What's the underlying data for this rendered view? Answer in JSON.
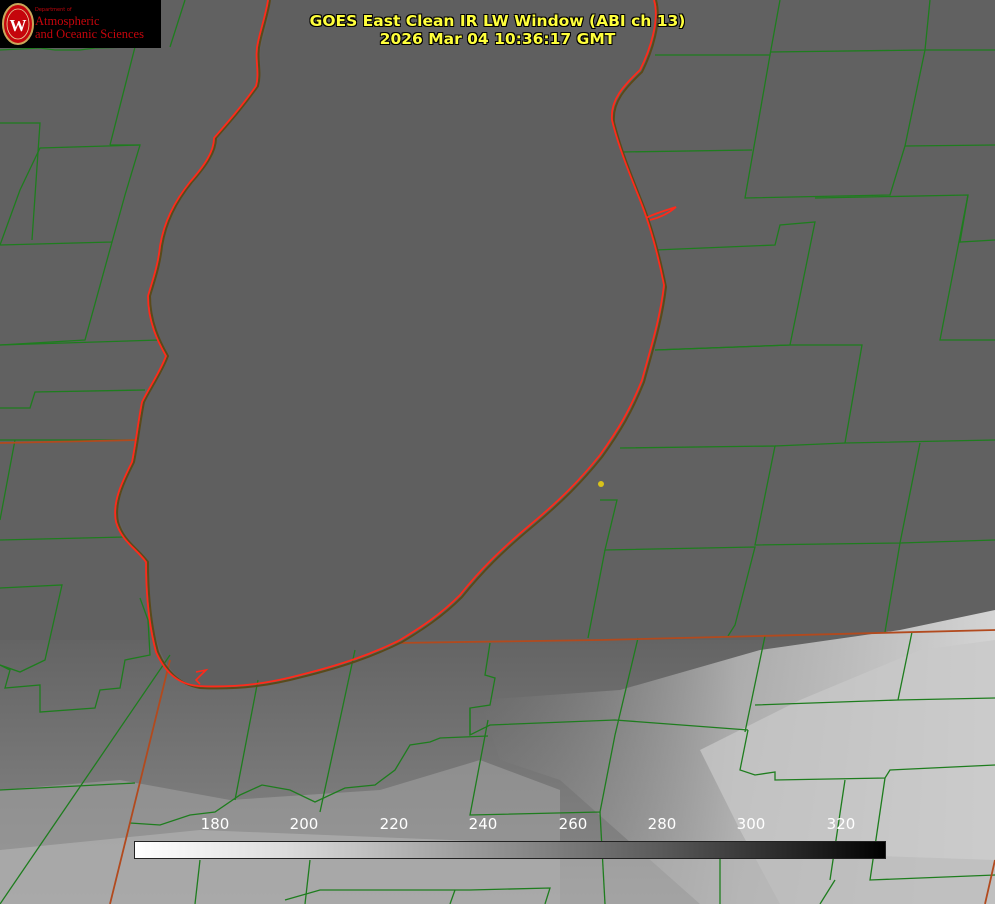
{
  "title": {
    "line1": "GOES East Clean IR LW Window (ABI ch 13)",
    "line2": "2026 Mar 04 10:36:17 GMT"
  },
  "logo": {
    "department": "Department of",
    "line1": "Atmospheric",
    "line2": "and Oceanic Sciences",
    "seal_letter": "W"
  },
  "colorbar": {
    "ticks": [
      "180",
      "200",
      "220",
      "240",
      "260",
      "280",
      "300",
      "320"
    ]
  },
  "colors": {
    "title": "#ffff3c",
    "county_lines": "#1e7d1e",
    "state_lines": "#b24a1e",
    "lake_outline": "#ff2a1a",
    "marker": "#d8c21a",
    "logo_red": "#c5050c"
  }
}
